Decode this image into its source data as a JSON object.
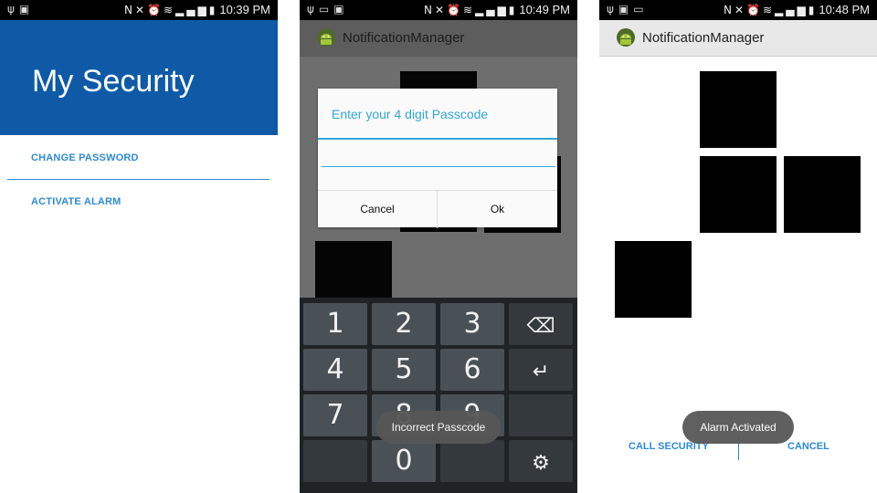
{
  "status_bar": {
    "left_icons": [
      "usb-icon",
      "image-icon",
      "voicemail-icon"
    ],
    "right_icons": [
      "nfc-icon",
      "mute-icon",
      "alarm-icon",
      "wifi-icon",
      "signal-icon",
      "battery-icon"
    ]
  },
  "screen1": {
    "time": "10:39 PM",
    "title": "My Security",
    "menu": [
      "CHANGE PASSWORD",
      "ACTIVATE ALARM"
    ],
    "colors": {
      "header": "#0e5aa7",
      "accent": "#2e8ad8"
    }
  },
  "screen2": {
    "time": "10:49 PM",
    "app_title": "NotificationManager",
    "dialog": {
      "title": "Enter your 4 digit Passcode",
      "input_value": "",
      "cancel": "Cancel",
      "ok": "Ok"
    },
    "keypad": {
      "row1": [
        "1",
        "2",
        "3"
      ],
      "row2": [
        "4",
        "5",
        "6"
      ],
      "row3": [
        "7",
        "8",
        "9"
      ],
      "zero": "0",
      "icons": [
        "backspace-icon",
        "enter-icon",
        "settings-icon"
      ]
    },
    "toast": "Incorrect Passcode",
    "colors": {
      "dialog_accent": "#34a6d8"
    }
  },
  "screen3": {
    "time": "10:48 PM",
    "app_title": "NotificationManager",
    "toast": "Alarm Activated",
    "buttons": {
      "call_security": "CALL SECURITY",
      "cancel": "CANCEL"
    }
  }
}
